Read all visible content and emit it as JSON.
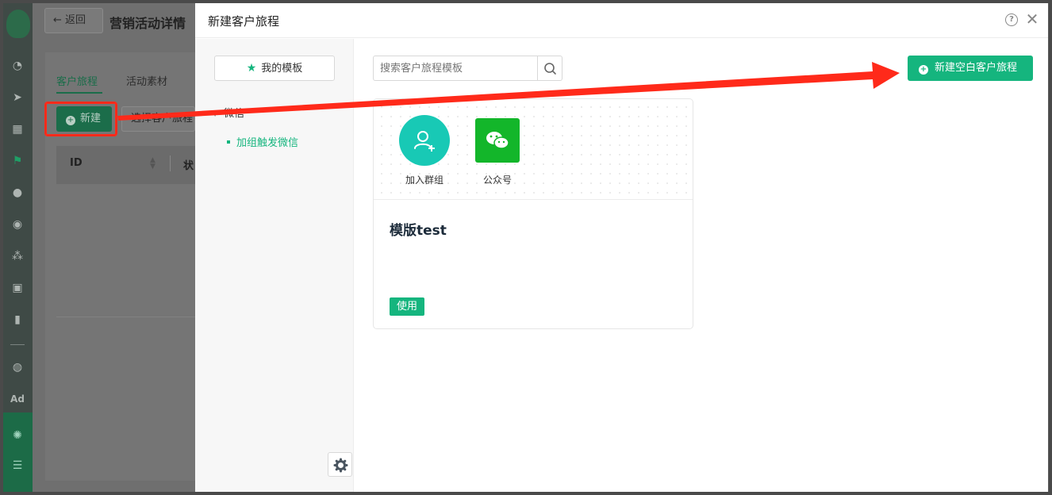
{
  "background_page": {
    "back_label": "返回",
    "title": "营销活动详情",
    "tabs": [
      {
        "label": "客户旅程"
      },
      {
        "label": "活动素材"
      }
    ],
    "new_button_label": "新建",
    "select_button_label": "选择客户旅程",
    "table_headers": [
      "ID",
      "状"
    ]
  },
  "rail": {
    "ad_label": "Ad"
  },
  "drawer": {
    "title": "新建客户旅程",
    "my_templates_label": "我的模板",
    "tree": {
      "group": "微信",
      "items": [
        "加组触发微信"
      ]
    },
    "search_placeholder": "搜索客户旅程模板",
    "new_blank_label": "新建空白客户旅程",
    "template_card": {
      "nodes": [
        {
          "label": "加入群组",
          "icon": "add-user-icon"
        },
        {
          "label": "公众号",
          "icon": "wechat-icon"
        }
      ],
      "name": "模版test",
      "use_label": "使用"
    }
  },
  "colors": {
    "brand_green": "#15b57e",
    "annotation_red": "#ff2a1a",
    "node_teal": "#18c9b5",
    "wechat_green": "#13b62a"
  }
}
